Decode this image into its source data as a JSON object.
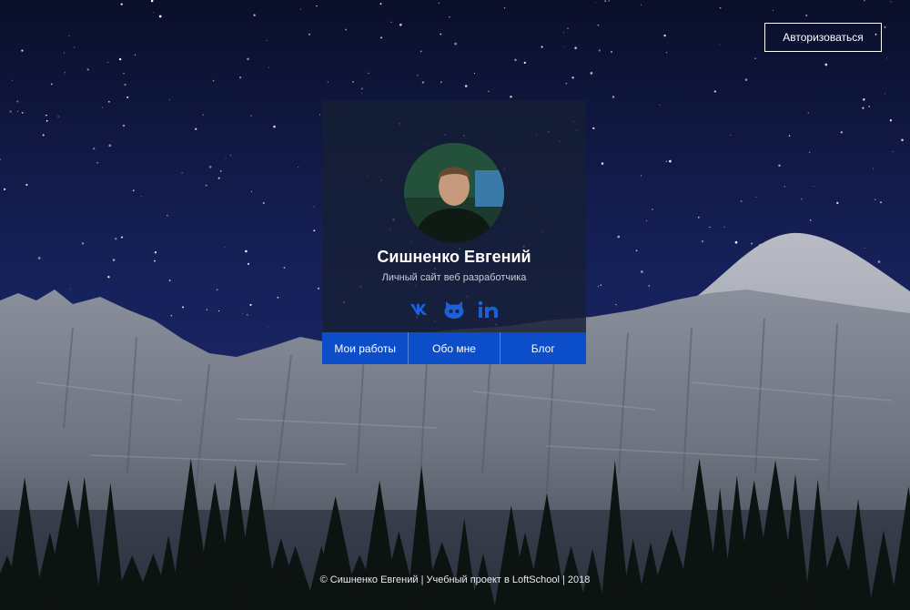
{
  "header": {
    "auth_label": "Авторизоваться"
  },
  "card": {
    "name": "Сишненко Евгений",
    "subtitle": "Личный сайт веб разработчика",
    "socials": [
      {
        "icon": "vk-icon"
      },
      {
        "icon": "github-icon"
      },
      {
        "icon": "linkedin-icon"
      }
    ],
    "nav": [
      {
        "label": "Мои работы"
      },
      {
        "label": "Обо мне"
      },
      {
        "label": "Блог"
      }
    ]
  },
  "footer": {
    "text": "© Сишненко Евгений | Учебный проект в LoftSchool | 2018"
  },
  "colors": {
    "accent": "#0c4ec9",
    "icon": "#1c5fd8",
    "card_bg": "#161e34"
  }
}
